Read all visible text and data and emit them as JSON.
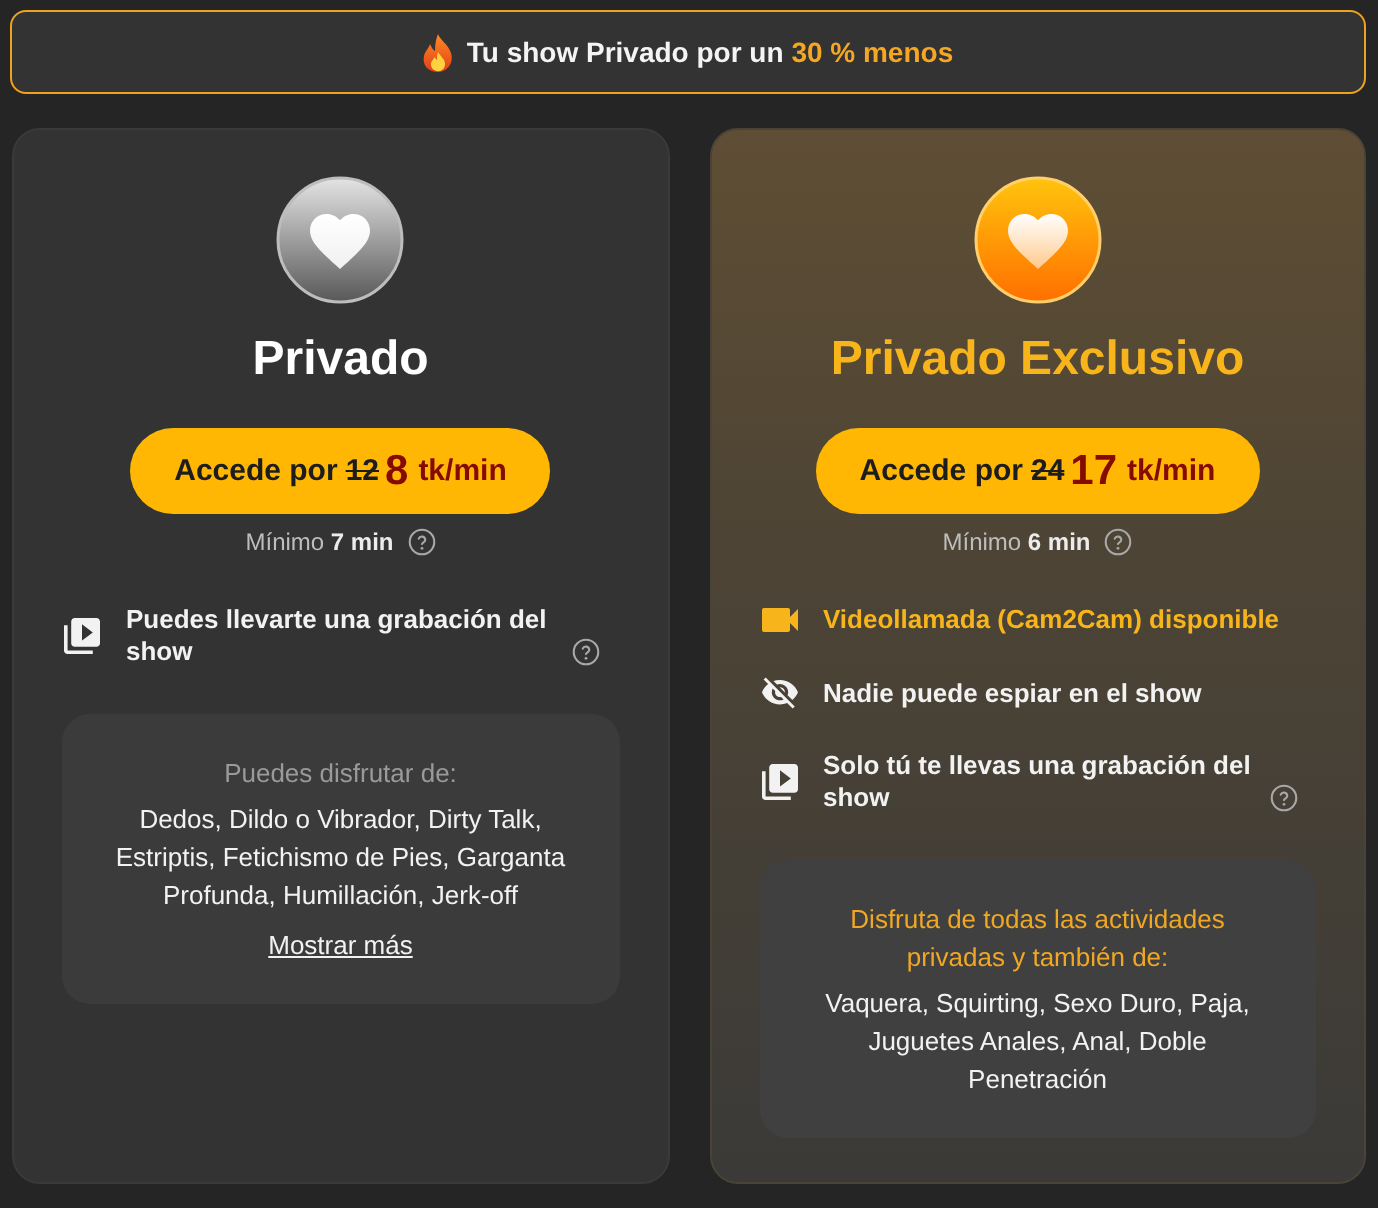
{
  "banner": {
    "text": "Tu show Privado por un",
    "highlight": "30 % menos"
  },
  "plans": [
    {
      "kind": "standard",
      "title": "Privado",
      "button": {
        "label": "Accede por",
        "old_price": "12",
        "price": "8",
        "unit": "tk/min"
      },
      "minimum": {
        "label": "Mínimo",
        "value": "7 min",
        "help": true
      },
      "features": [
        {
          "kind": "recording",
          "text": "Puedes llevarte una grabación del show",
          "help": true,
          "highlighted": false
        }
      ],
      "extras": {
        "title": "Puedes disfrutar de:",
        "items": "Dedos, Dildo o Vibrador, Dirty Talk, Estriptis, Fetichismo de Pies, Garganta Profunda, Humillación, Jerk-off",
        "link": "Mostrar más"
      }
    },
    {
      "kind": "exclusive",
      "title": "Privado Exclusivo",
      "button": {
        "label": "Accede por",
        "old_price": "24",
        "price": "17",
        "unit": "tk/min"
      },
      "minimum": {
        "label": "Mínimo",
        "value": "6 min",
        "help": true
      },
      "features": [
        {
          "kind": "video",
          "text": "Videollamada (Cam2Cam) disponible",
          "help": false,
          "highlighted": true
        },
        {
          "kind": "privacy",
          "text": "Nadie puede espiar en el show",
          "help": false,
          "highlighted": false
        },
        {
          "kind": "recording",
          "text": "Solo tú te llevas una grabación del show",
          "help": true,
          "highlighted": false
        }
      ],
      "extras": {
        "title": "Disfruta de todas las actividades privadas y también de:",
        "items": "Vaquera, Squirting, Sexo Duro, Paja, Juguetes Anales, Anal, Doble Penetración"
      }
    }
  ]
}
